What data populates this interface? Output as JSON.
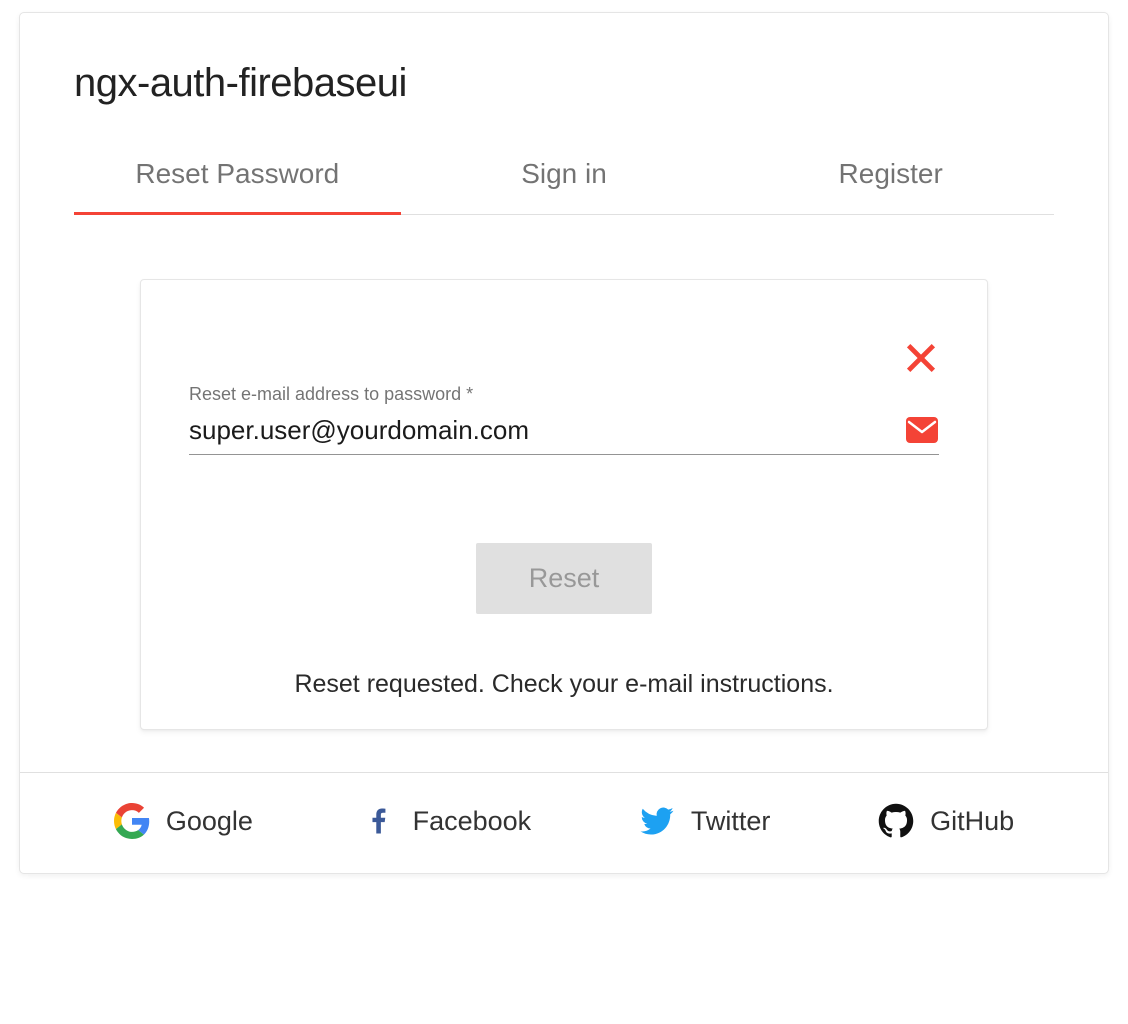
{
  "header": {
    "title": "ngx-auth-firebaseui"
  },
  "tabs": {
    "reset": "Reset Password",
    "signin": "Sign in",
    "register": "Register"
  },
  "reset": {
    "field_label": "Reset e-mail address to password *",
    "email_value": "super.user@yourdomain.com",
    "button_label": "Reset",
    "status_message": "Reset requested. Check your e-mail instructions."
  },
  "providers": {
    "google": "Google",
    "facebook": "Facebook",
    "twitter": "Twitter",
    "github": "GitHub"
  },
  "colors": {
    "accent": "#f44336"
  }
}
